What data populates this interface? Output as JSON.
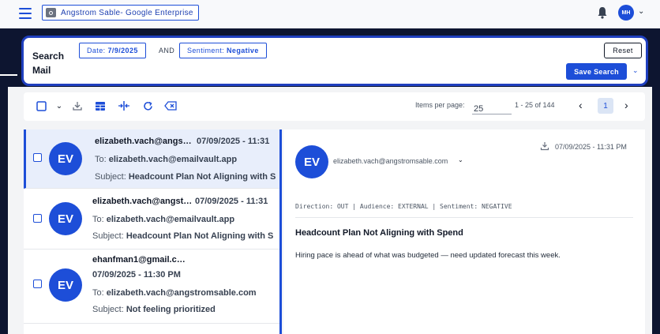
{
  "header": {
    "org_name": "Angstrom Sable- Google Enterprise",
    "user_initials": "MH",
    "icons": [
      "menu-icon",
      "org-icon",
      "bell-icon",
      "chevron-down-icon"
    ]
  },
  "search": {
    "title": "Search Mail",
    "filters": [
      {
        "key": "Date:",
        "value": "7/9/2025"
      },
      {
        "key": "Sentiment:",
        "value": "Negative"
      }
    ],
    "operator": "AND",
    "reset_label": "Reset",
    "save_label": "Save Search"
  },
  "toolbar": {
    "icons": [
      "select-all-checkbox",
      "chevron-down-icon",
      "download-icon",
      "table-view-icon",
      "split-view-icon",
      "refresh-icon",
      "clear-icon"
    ],
    "items_per_page_label": "Items per page:",
    "items_per_page_value": "25",
    "range_text": "1 - 25 of 144",
    "current_page": "1"
  },
  "messages": [
    {
      "initials": "EV",
      "from": "elizabeth.vach@angs…",
      "date": "07/09/2025 - 11:31",
      "to_label": "To:",
      "to": "elizabeth.vach@emailvault.app",
      "subject_label": "Subject:",
      "subject": "Headcount Plan Not Aligning with S"
    },
    {
      "initials": "EV",
      "from": "elizabeth.vach@angst…",
      "date": "07/09/2025 - 11:31",
      "to_label": "To:",
      "to": "elizabeth.vach@emailvault.app",
      "subject_label": "Subject:",
      "subject": "Headcount Plan Not Aligning with S"
    },
    {
      "initials": "EV",
      "from": "ehanfman1@gmail.c…",
      "date": "07/09/2025 - 11:30 PM",
      "to_label": "To:",
      "to": "elizabeth.vach@angstromsable.com",
      "subject_label": "Subject:",
      "subject": "Not feeling prioritized"
    }
  ],
  "detail": {
    "initials": "EV",
    "from": "elizabeth.vach@angstromsable.com",
    "date": "07/09/2025 - 11:31 PM",
    "meta": "Direction: OUT | Audience: EXTERNAL | Sentiment: NEGATIVE",
    "subject": "Headcount Plan Not Aligning with Spend",
    "body": "Hiring pace is ahead of what was budgeted — need updated forecast this week."
  },
  "colors": {
    "accent": "#1d4ed8",
    "dark_bg": "#0d1530",
    "selected_bg": "#e8eefb"
  }
}
